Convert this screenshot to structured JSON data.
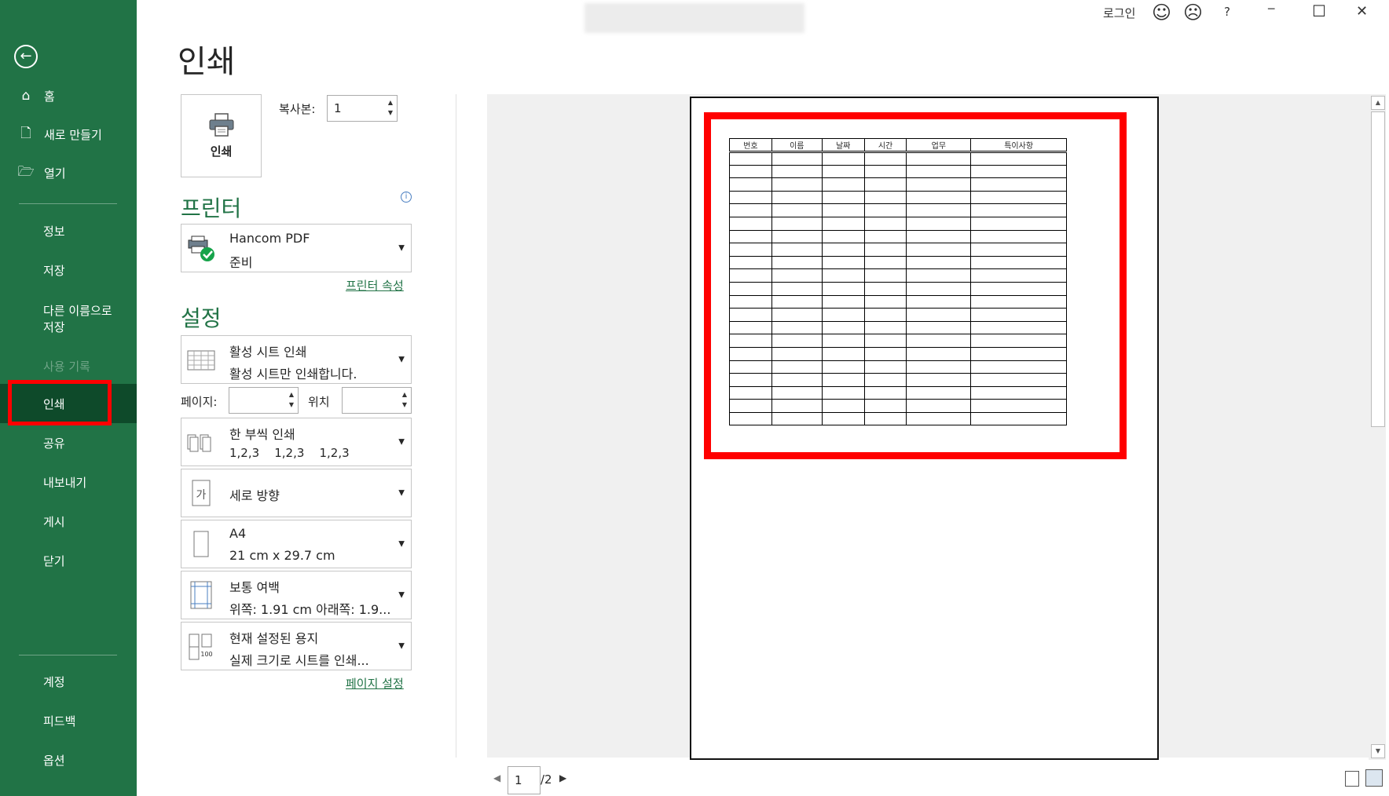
{
  "window": {
    "login": "로그인",
    "help": "?",
    "minimize": "─",
    "maximize": "☐",
    "close": "✕",
    "smile": "☺",
    "frown": "☹"
  },
  "sidebar": {
    "back": "←",
    "items": [
      {
        "label": "홈",
        "icon": "home-icon"
      },
      {
        "label": "새로 만들기",
        "icon": "new-document-icon"
      },
      {
        "label": "열기",
        "icon": "open-folder-icon"
      },
      {
        "label": "정보"
      },
      {
        "label": "저장"
      },
      {
        "label": "다른 이름으로\n저장"
      },
      {
        "label": "사용 기록"
      },
      {
        "label": "인쇄"
      },
      {
        "label": "공유"
      },
      {
        "label": "내보내기"
      },
      {
        "label": "게시"
      },
      {
        "label": "닫기"
      },
      {
        "label": "계정"
      },
      {
        "label": "피드백"
      },
      {
        "label": "옵션"
      }
    ],
    "save_as_1": "다른 이름으로",
    "save_as_2": "저장"
  },
  "main": {
    "title": "인쇄",
    "print_button": "인쇄",
    "copies_label": "복사본:",
    "copies_value": "1",
    "printer_section": "프린터",
    "printer_name": "Hancom PDF",
    "printer_status": "준비",
    "printer_properties": "프린터 속성",
    "settings_section": "설정",
    "settings": [
      {
        "line1": "활성 시트 인쇄",
        "line2": "활성 시트만 인쇄합니다."
      },
      {
        "line1": "한 부씩 인쇄",
        "line2": "1,2,3    1,2,3    1,2,3"
      },
      {
        "line1": "세로 방향",
        "line2": ""
      },
      {
        "line1": "A4",
        "line2": "21 cm x 29.7 cm"
      },
      {
        "line1": "보통 여백",
        "line2": "위쪽: 1.91 cm 아래쪽: 1.9..."
      },
      {
        "line1": "현재 설정된 용지",
        "line2": "실제 크기로 시트를 인쇄..."
      }
    ],
    "pages_label": "페이지:",
    "position_label": "위치",
    "page_setup": "페이지 설정"
  },
  "preview": {
    "columns": [
      "번호",
      "이름",
      "날짜",
      "시간",
      "업무",
      "특이사항"
    ],
    "row_count": 21,
    "current_page": "1",
    "total_pages": "/2"
  },
  "colors": {
    "accent": "#217346",
    "selected": "#0e4a2a",
    "highlight": "#ff0000"
  }
}
